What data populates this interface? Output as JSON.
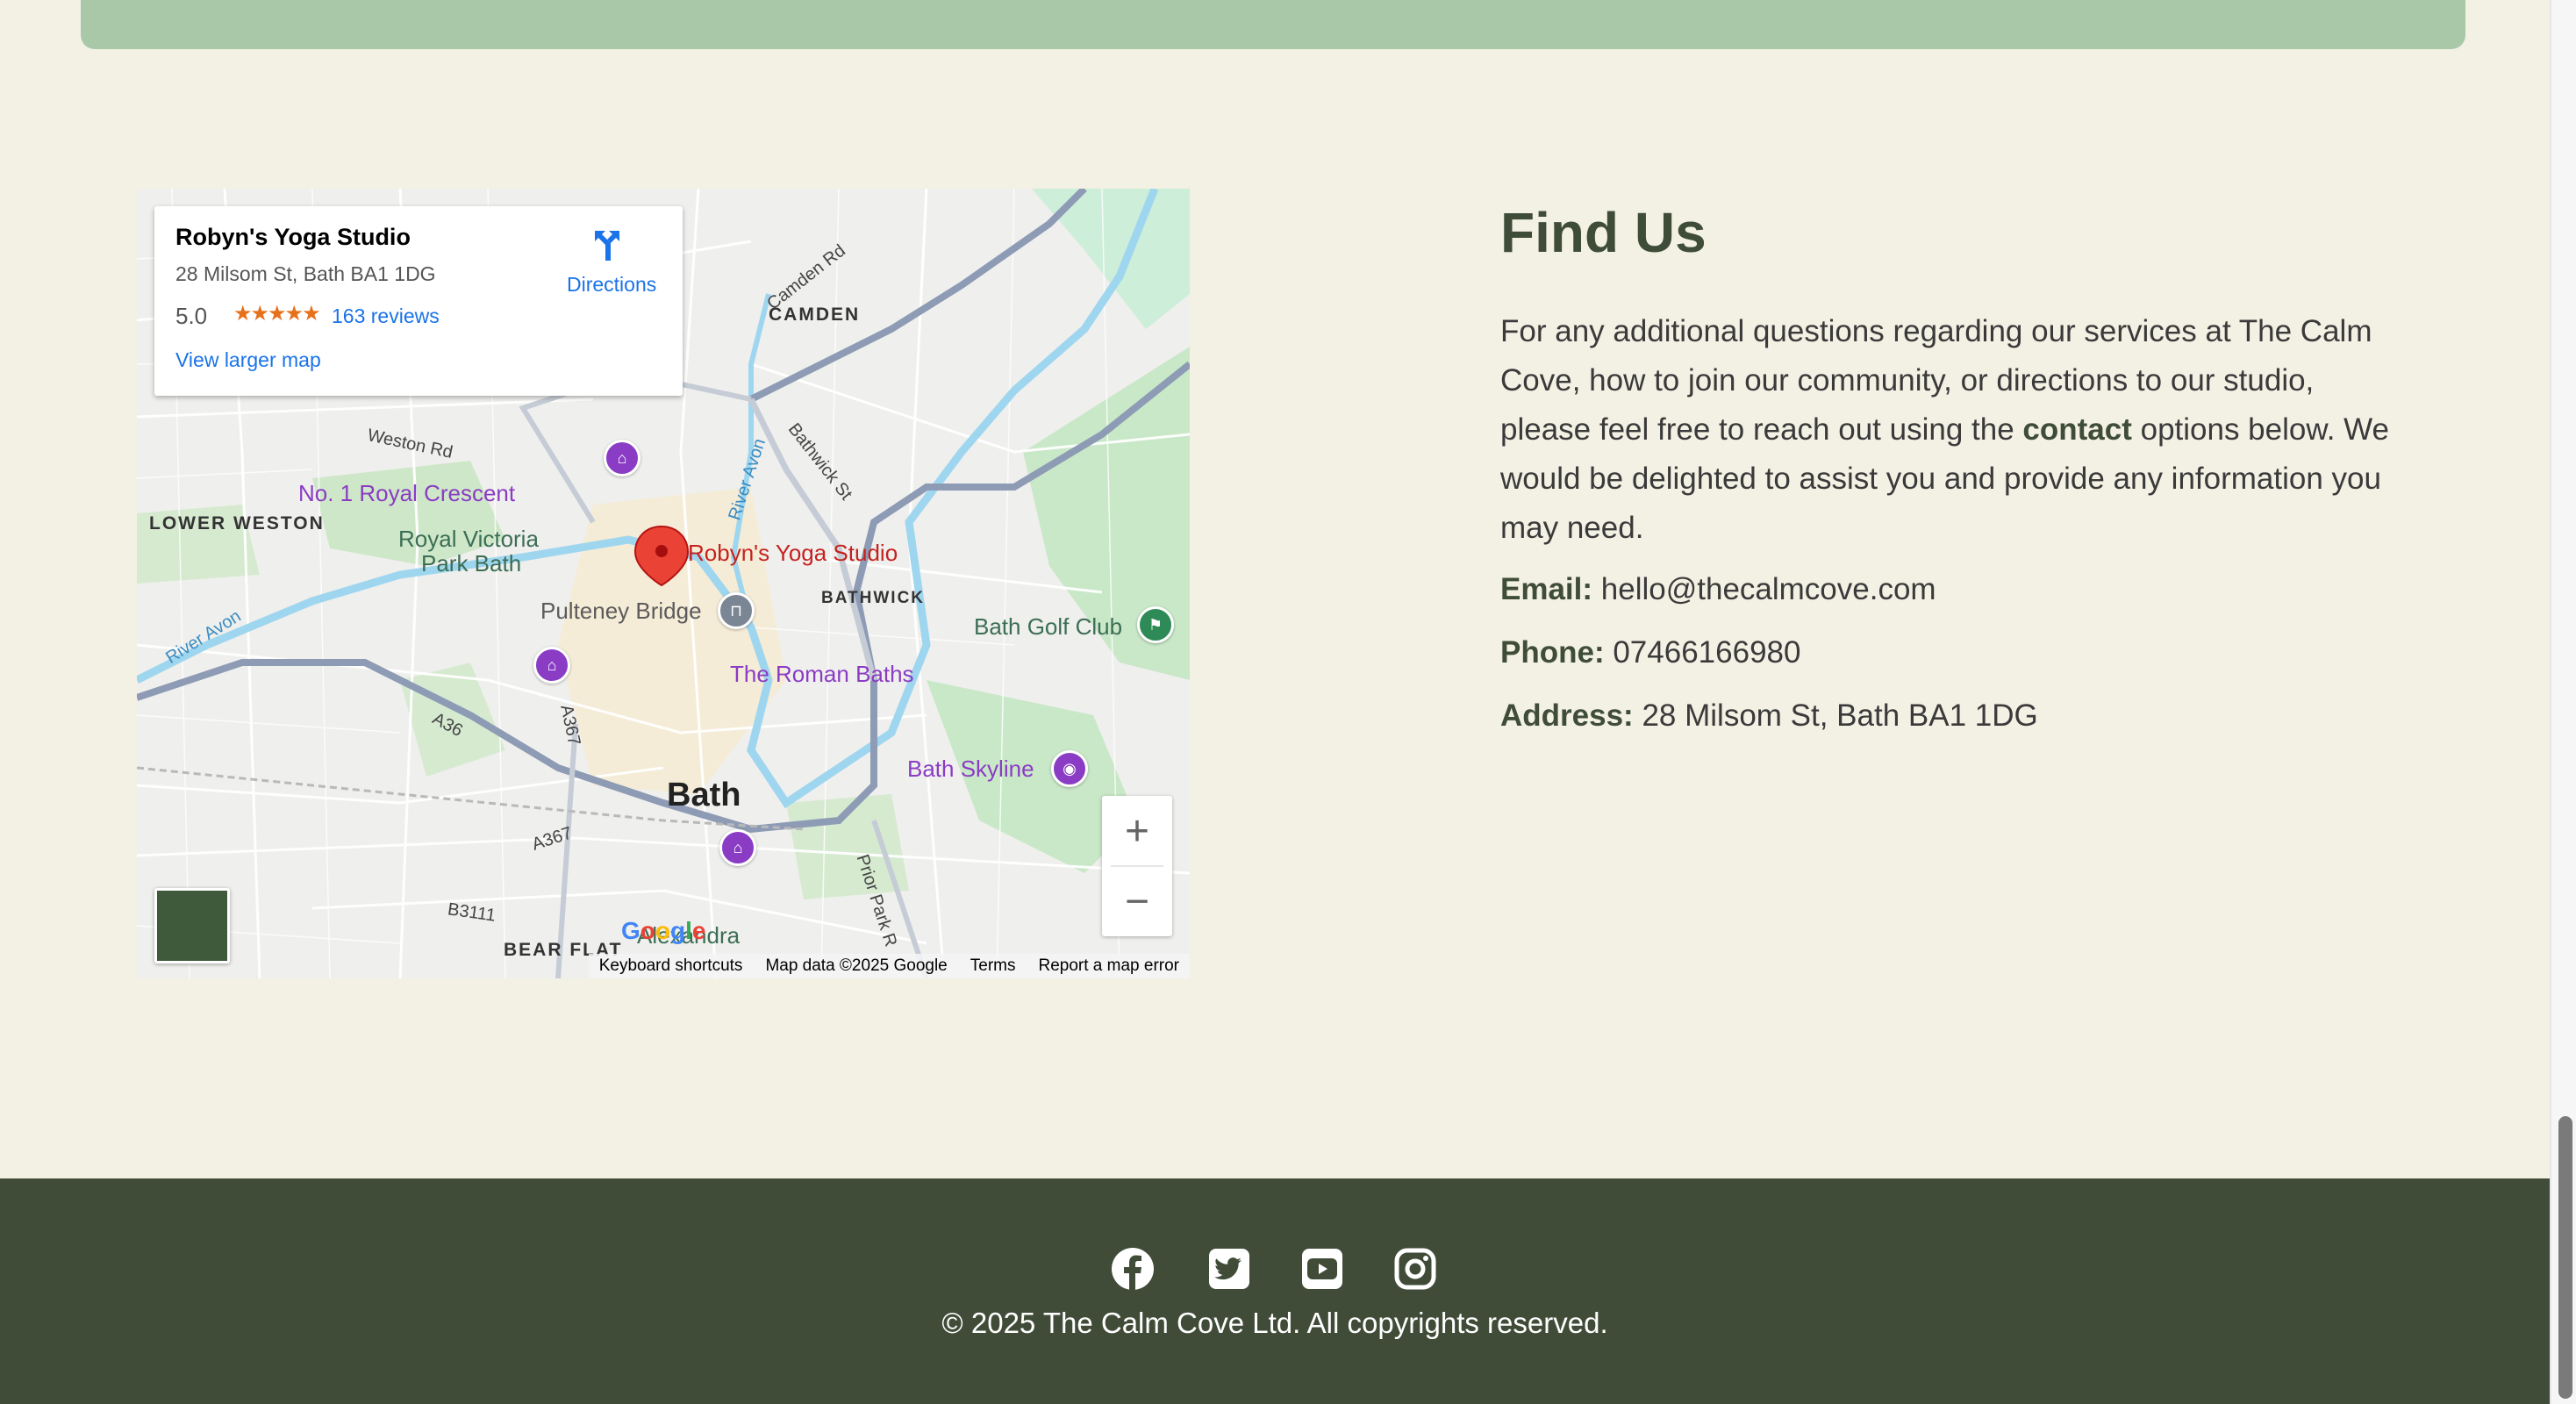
{
  "map": {
    "card": {
      "title": "Robyn's Yoga Studio",
      "address": "28 Milsom St, Bath BA1 1DG",
      "rating": "5.0",
      "stars": "★★★★★",
      "reviews": "163 reviews",
      "directions": "Directions",
      "larger_map": "View larger map"
    },
    "labels": {
      "camden": "CAMDEN",
      "camden_rd": "Camden Rd",
      "weston_rd": "Weston Rd",
      "royal_crescent": "No. 1 Royal Crescent",
      "lower_weston": "LOWER WESTON",
      "royal_victoria": "Royal Victoria",
      "park_bath": "Park Bath",
      "river_avon_1": "River Avon",
      "river_avon_2": "River Avon",
      "bathwick_st": "Bathwick St",
      "pin": "Robyn's Yoga Studio",
      "pulteney": "Pulteney Bridge",
      "bathwick": "BATHWICK",
      "golf": "Bath Golf Club",
      "roman_baths": "The Roman Baths",
      "a36": "A36",
      "a367_1": "A367",
      "a367_2": "A367",
      "bath": "Bath",
      "skyline": "Bath Skyline",
      "b3111": "B3111",
      "bear_flat": "BEAR FLAT",
      "alexandra": "Alexandra",
      "prior_park": "Prior Park R"
    },
    "google": "Google",
    "attribution": [
      "Keyboard shortcuts",
      "Map data ©2025 Google",
      "Terms",
      "Report a map error"
    ],
    "zoom_in": "+",
    "zoom_out": "−"
  },
  "find_us": {
    "title": "Find Us",
    "body_before": "For any additional questions regarding our services at The Calm Cove, how to join our community, or directions to our studio, please feel free to reach out using the ",
    "body_bold": "contact",
    "body_after": " options below. We would be delighted to assist you and provide any information you may need.",
    "email_label": "Email:",
    "email": "hello@thecalmcove.com",
    "phone_label": "Phone:",
    "phone": "07466166980",
    "address_label": "Address:",
    "address": "28 Milsom St, Bath BA1 1DG"
  },
  "footer": {
    "social_icons": [
      "facebook-icon",
      "twitter-icon",
      "youtube-icon",
      "instagram-icon"
    ],
    "copyright": "© 2025 The Calm Cove Ltd. All copyrights reserved."
  },
  "colors": {
    "background": "#f3f0e4",
    "banner": "#a8c8a8",
    "footer": "#404c38",
    "heading": "#3f4d38"
  }
}
